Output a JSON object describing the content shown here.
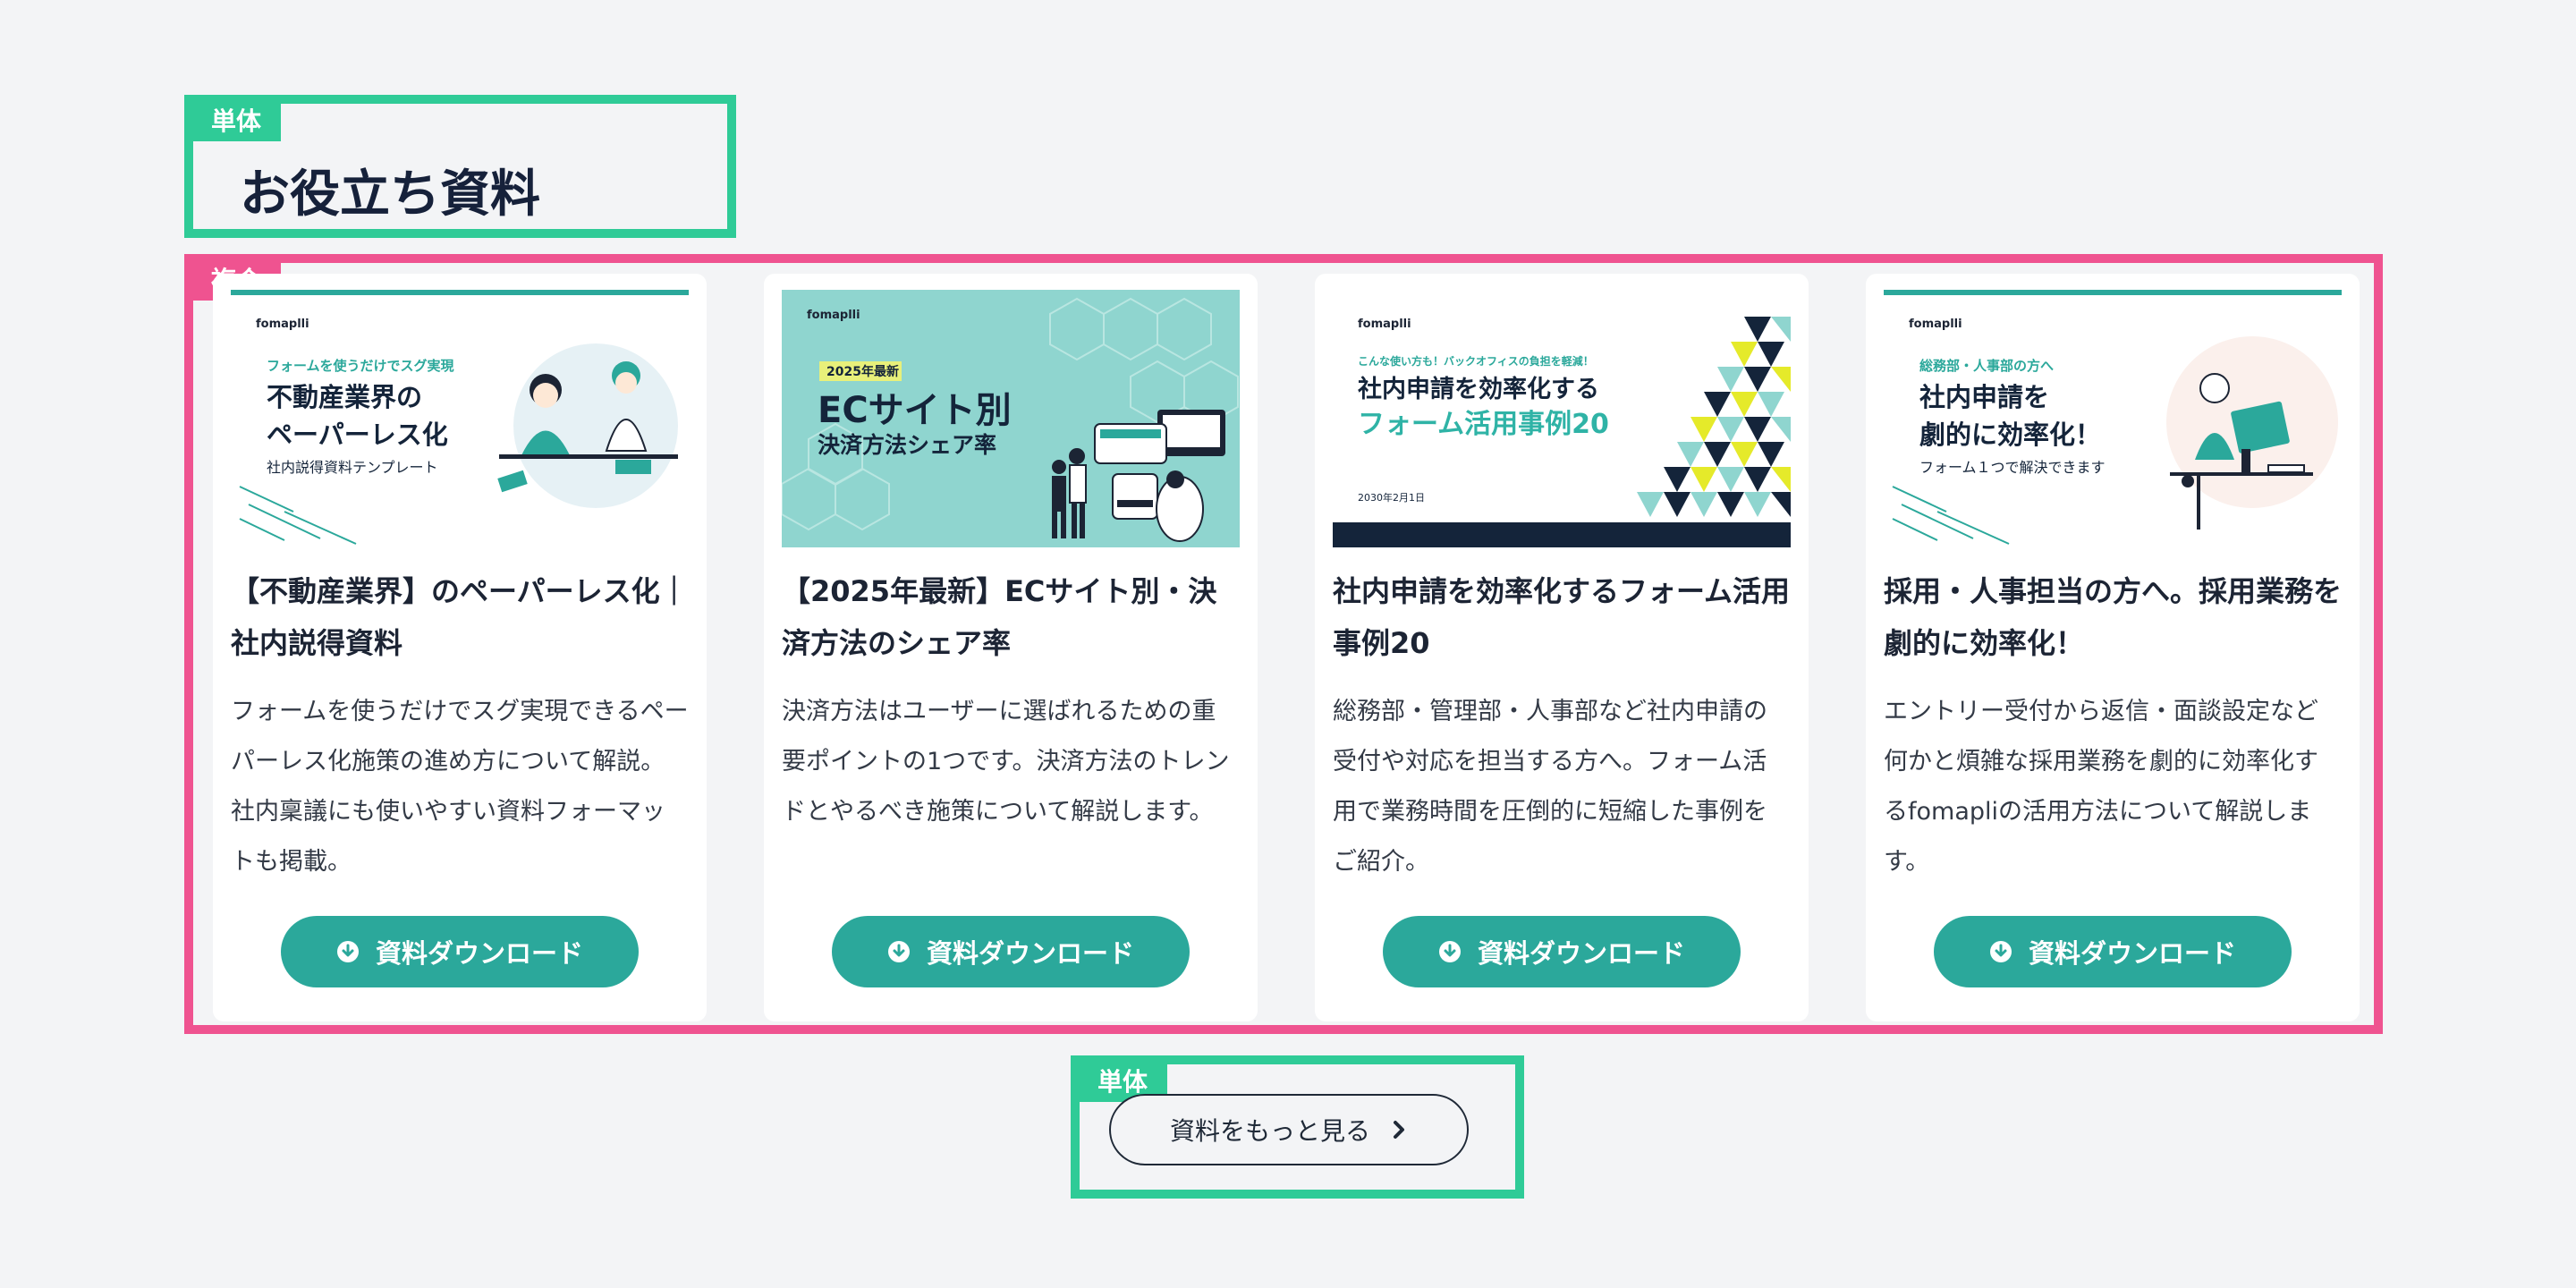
{
  "labels": {
    "single": "単体",
    "composite": "複合"
  },
  "page_title": "お役立ち資料",
  "download_label": "資料ダウンロード",
  "more_button": "資料をもっと見る",
  "cards": [
    {
      "title": "【不動産業界】のペーパーレス化｜社内説得資料",
      "description": "フォームを使うだけでスグ実現できるペーパーレス化施策の進め方について解説。社内稟議にも使いやすい資料フォーマットも掲載。",
      "thumb": {
        "brand": "fomaplli",
        "kicker": "フォームを使うだけでスグ実現",
        "line1": "不動産業界の",
        "line2": "ペーパーレス化",
        "sub": "社内説得資料テンプレート"
      }
    },
    {
      "title": "【2025年最新】ECサイト別・決済方法のシェア率",
      "description": "決済方法はユーザーに選ばれるための重要ポイントの1つです。決済方法のトレンドとやるべき施策について解説します。",
      "thumb": {
        "brand": "fomaplli",
        "badge": "2025年最新",
        "line1": "ECサイト別",
        "line2": "決済方法シェア率"
      }
    },
    {
      "title": "社内申請を効率化するフォーム活用事例20",
      "description": "総務部・管理部・人事部など社内申請の受付や対応を担当する方へ。フォーム活用で業務時間を圧倒的に短縮した事例をご紹介。",
      "thumb": {
        "brand": "fomaplli",
        "kicker": "こんな使い方も！バックオフィスの負担を軽減！",
        "line1": "社内申請を効率化する",
        "line2": "フォーム活用事例20",
        "date": "2030年2月1日"
      }
    },
    {
      "title": "採用・人事担当の方へ。採用業務を劇的に効率化！",
      "description": "エントリー受付から返信・面談設定など何かと煩雑な採用業務を劇的に効率化するfomapliの活用方法について解説します。",
      "thumb": {
        "brand": "fomaplli",
        "kicker": "総務部・人事部の方へ",
        "line1": "社内申請を",
        "line2": "劇的に効率化！",
        "sub": "フォーム１つで解決できます"
      }
    }
  ],
  "colors": {
    "label_green": "#2fcb97",
    "label_pink": "#ef5390",
    "button_teal": "#2ba89b",
    "thumb_mint": "#8fd5cf",
    "navy": "#14243a"
  },
  "icons": {
    "download": "download-circle-icon",
    "more": "chevron-right-icon"
  }
}
